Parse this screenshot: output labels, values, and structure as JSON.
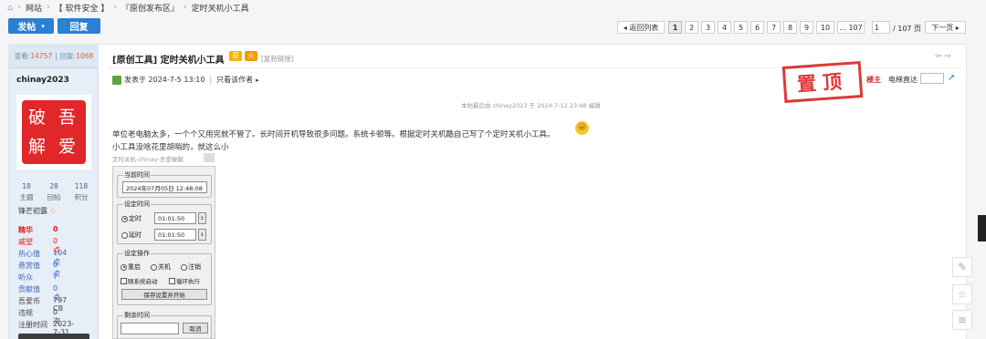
{
  "breadcrumb": {
    "items": [
      "网站",
      "【 软件安全 】",
      "『原创发布区』",
      "定时关机小工具"
    ],
    "sep": "›"
  },
  "actions": {
    "post": "发帖",
    "post_arrow": "▾",
    "reply": "回复"
  },
  "pagination": {
    "back": "◂ 返回列表",
    "pages": [
      "1",
      "2",
      "3",
      "4",
      "5",
      "6",
      "7",
      "8",
      "9",
      "10"
    ],
    "ellipsis_last": "... 107",
    "input": "1",
    "total": "/ 107 页",
    "next": "下一页 ▸"
  },
  "sidebar": {
    "views_label": "查看:",
    "views": "14757",
    "replies_label": "回复:",
    "replies": "1068",
    "username": "chinay2023",
    "avatar_text": [
      "破 吾",
      "解 爱"
    ],
    "counts": [
      {
        "value": "18",
        "label": "主题"
      },
      {
        "value": "28",
        "label": "回帖"
      },
      {
        "value": "118",
        "label": "积分"
      }
    ],
    "rank": "锋芒初露",
    "properties": [
      {
        "label": "精华",
        "value": "0",
        "style": "red"
      },
      {
        "label": "威望",
        "value": "0 点",
        "style": "red-val"
      },
      {
        "label": "热心值",
        "value": "104 点",
        "style": "blue"
      },
      {
        "label": "悬赏值",
        "value": "0 点",
        "style": "blue"
      },
      {
        "label": "听众",
        "value": "7",
        "style": "blue"
      },
      {
        "label": "贡献值",
        "value": "0 点",
        "style": "blue"
      },
      {
        "label": "吾爱币",
        "value": "797 CB",
        "style": "plain"
      },
      {
        "label": "违规",
        "value": "0 次",
        "style": "plain"
      },
      {
        "label": "注册时间",
        "value": "2023-7-31",
        "style": "plain"
      }
    ]
  },
  "post": {
    "title": "[原创工具] 定时关机小工具",
    "badges": [
      "原",
      "火"
    ],
    "copy_link": "[复制链接]",
    "nav": "⇦ ⇨",
    "posted": "发表于 2024-7-5 13:10",
    "separator": "|",
    "only_author": "只看该作者",
    "only_author_arrow": "▸",
    "stamp": "置顶",
    "louzhu": "楼主",
    "floor_jump": "电梯直达",
    "floor_go": "➚",
    "edit_note": "本帖最后由 chinay2023 于 2024-7-12 23:48 编辑",
    "body_line1": "单位老电脑太多，一个个又用完就不管了。长时间开机导致很多问题。系统卡顿等。根据定时关机酷自己写了个定时关机小工具。",
    "body_line2": "小工具没啥花里胡哨的，就这么小",
    "emoji": "😀",
    "caption": "定时关机-chinay-吾爱破解"
  },
  "app": {
    "current_group": "当前时间",
    "current_time": "2024年07月05日 12:48:08",
    "set_group": "设定时间",
    "opt_timed": "定时",
    "opt_delay": "延时",
    "time1": "01:01:50",
    "time2": "01:01:50",
    "action_group": "设定操作",
    "act_restart": "重启",
    "act_shutdown": "关机",
    "act_logout": "注销",
    "chk_autostart": "随系统启动",
    "chk_loop": "循环执行",
    "save_btn": "保存设置并开始",
    "remain_group": "剩余时间",
    "cancel_btn": "取消"
  },
  "tools": [
    "✎",
    "☆",
    "≡"
  ]
}
